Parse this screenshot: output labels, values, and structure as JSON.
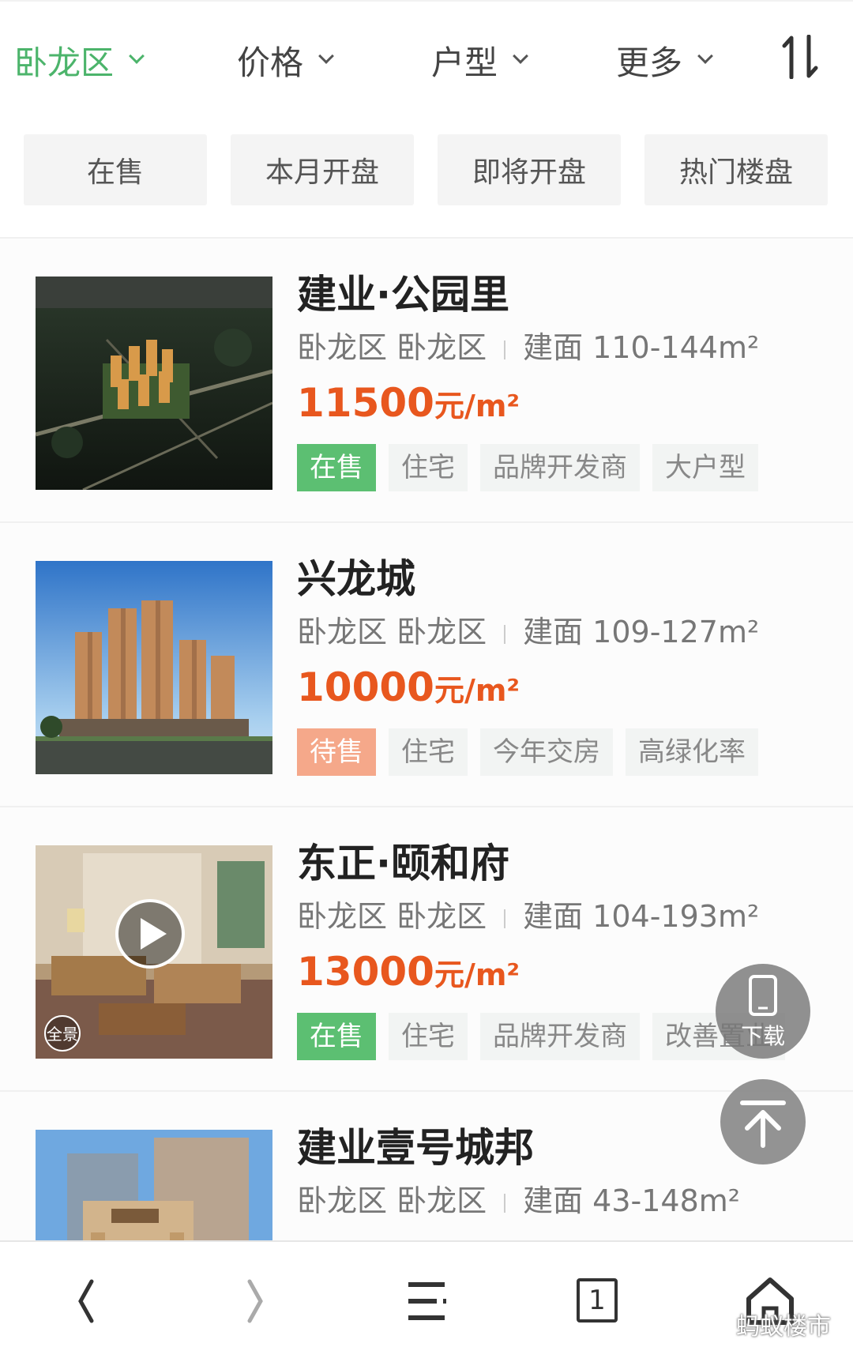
{
  "filters": {
    "district": "卧龙区",
    "price": "价格",
    "layout": "户型",
    "more": "更多"
  },
  "quick_filters": [
    "在售",
    "本月开盘",
    "即将开盘",
    "热门楼盘"
  ],
  "listings": [
    {
      "name": "建业·公园里",
      "district": "卧龙区 卧龙区",
      "area": "建面 110-144m²",
      "price": "11500",
      "price_unit": "元/m²",
      "status": "在售",
      "tags": [
        "住宅",
        "品牌开发商",
        "大户型"
      ]
    },
    {
      "name": "兴龙城",
      "district": "卧龙区 卧龙区",
      "area": "建面 109-127m²",
      "price": "10000",
      "price_unit": "元/m²",
      "status": "待售",
      "tags": [
        "住宅",
        "今年交房",
        "高绿化率"
      ]
    },
    {
      "name": "东正·颐和府",
      "district": "卧龙区 卧龙区",
      "area": "建面 104-193m²",
      "price": "13000",
      "price_unit": "元/m²",
      "status": "在售",
      "tags": [
        "住宅",
        "品牌开发商",
        "改善置业"
      ],
      "pano_badge": "全景"
    },
    {
      "name": "建业壹号城邦",
      "district": "卧龙区 卧龙区",
      "area": "建面 43-148m²"
    }
  ],
  "floating": {
    "download_label": "下载"
  },
  "bottom_nav": {
    "tab_count": "1"
  },
  "watermark": "蚂蚁楼市",
  "colors": {
    "accent_green": "#4cb46b",
    "price_orange": "#e8571e",
    "on_sale": "#5cbf72",
    "pending": "#f5a88a"
  }
}
